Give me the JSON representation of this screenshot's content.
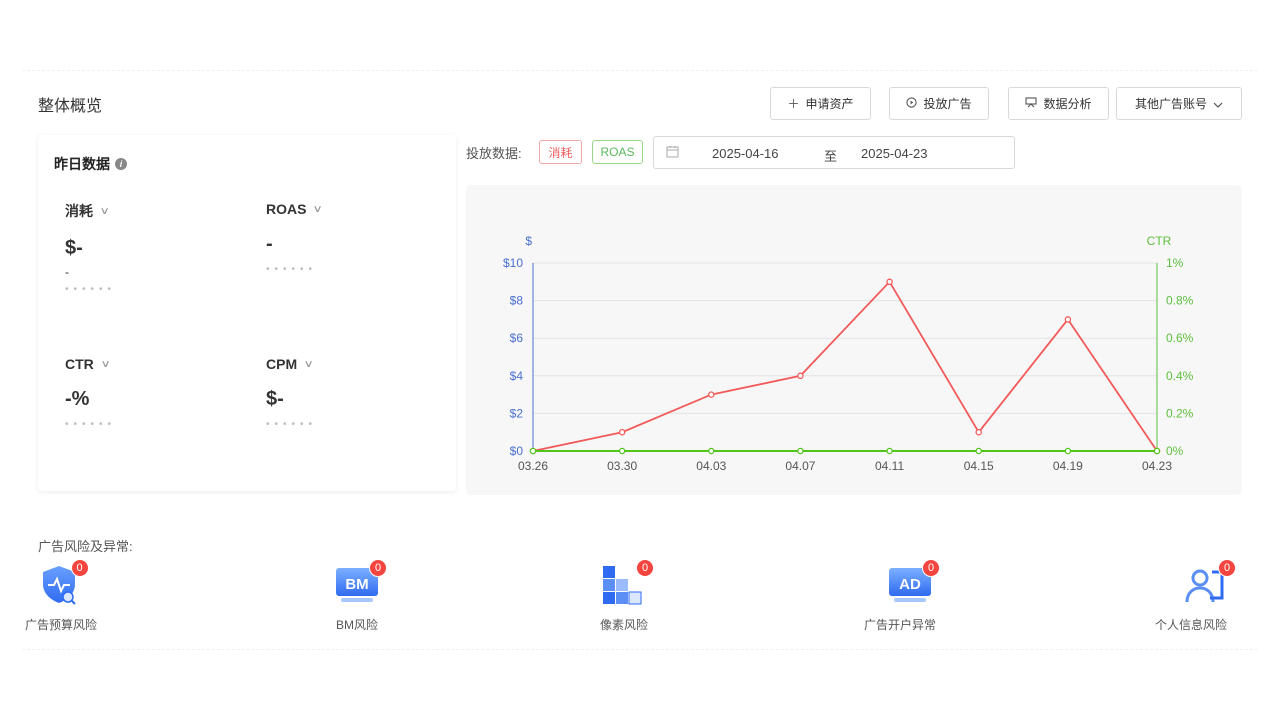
{
  "page": {
    "title": "整体概览"
  },
  "toolbar": {
    "apply_assets": "申请资产",
    "place_ad": "投放广告",
    "data_analysis": "数据分析",
    "other_accounts": "其他广告账号"
  },
  "yesterday": {
    "title": "昨日数据",
    "metrics": [
      {
        "label": "消耗",
        "value": "$-",
        "sub": "-",
        "dots": "••••••"
      },
      {
        "label": "ROAS",
        "value": "-",
        "sub": "",
        "dots": "••••••"
      },
      {
        "label": "CTR",
        "value": "-%",
        "sub": "",
        "dots": "••••••"
      },
      {
        "label": "CPM",
        "value": "$-",
        "sub": "",
        "dots": "••••••"
      }
    ]
  },
  "filter": {
    "label": "投放数据:",
    "tag_spend": "消耗",
    "tag_roas": "ROAS",
    "date_start": "2025-04-16",
    "date_sep": "至",
    "date_end": "2025-04-23"
  },
  "colors": {
    "spend_line": "#f25a5a",
    "ctr_line": "#52c41a",
    "left_axis": "#4a6fd0",
    "right_axis": "#5cbf3c"
  },
  "chart_data": {
    "type": "line",
    "x": [
      "03.26",
      "03.30",
      "04.03",
      "04.07",
      "04.11",
      "04.15",
      "04.19",
      "04.23"
    ],
    "series": [
      {
        "name": "消耗",
        "axis": "left",
        "values": [
          0,
          1,
          3,
          4,
          9,
          1,
          7,
          0
        ]
      },
      {
        "name": "CTR",
        "axis": "right",
        "values": [
          0,
          0,
          0,
          0,
          0,
          0,
          0,
          0
        ]
      }
    ],
    "left_axis": {
      "label": "$",
      "ylim": [
        0,
        10
      ],
      "ticks": [
        "$0",
        "$2",
        "$4",
        "$6",
        "$8",
        "$10"
      ]
    },
    "right_axis": {
      "label": "CTR",
      "ylim": [
        0,
        1
      ],
      "ticks": [
        "0%",
        "0.2%",
        "0.4%",
        "0.6%",
        "0.8%",
        "1%"
      ]
    },
    "grid": true
  },
  "risks": {
    "title": "广告风险及异常:",
    "items": [
      {
        "label": "广告预算风险",
        "count": "0",
        "icon": "shield-pulse-icon"
      },
      {
        "label": "BM风险",
        "count": "0",
        "icon": "bm-monitor-icon",
        "glyph": "BM"
      },
      {
        "label": "像素风险",
        "count": "0",
        "icon": "pixel-blocks-icon"
      },
      {
        "label": "广告开户异常",
        "count": "0",
        "icon": "ad-monitor-icon",
        "glyph": "AD"
      },
      {
        "label": "个人信息风险",
        "count": "0",
        "icon": "person-card-icon"
      }
    ]
  }
}
